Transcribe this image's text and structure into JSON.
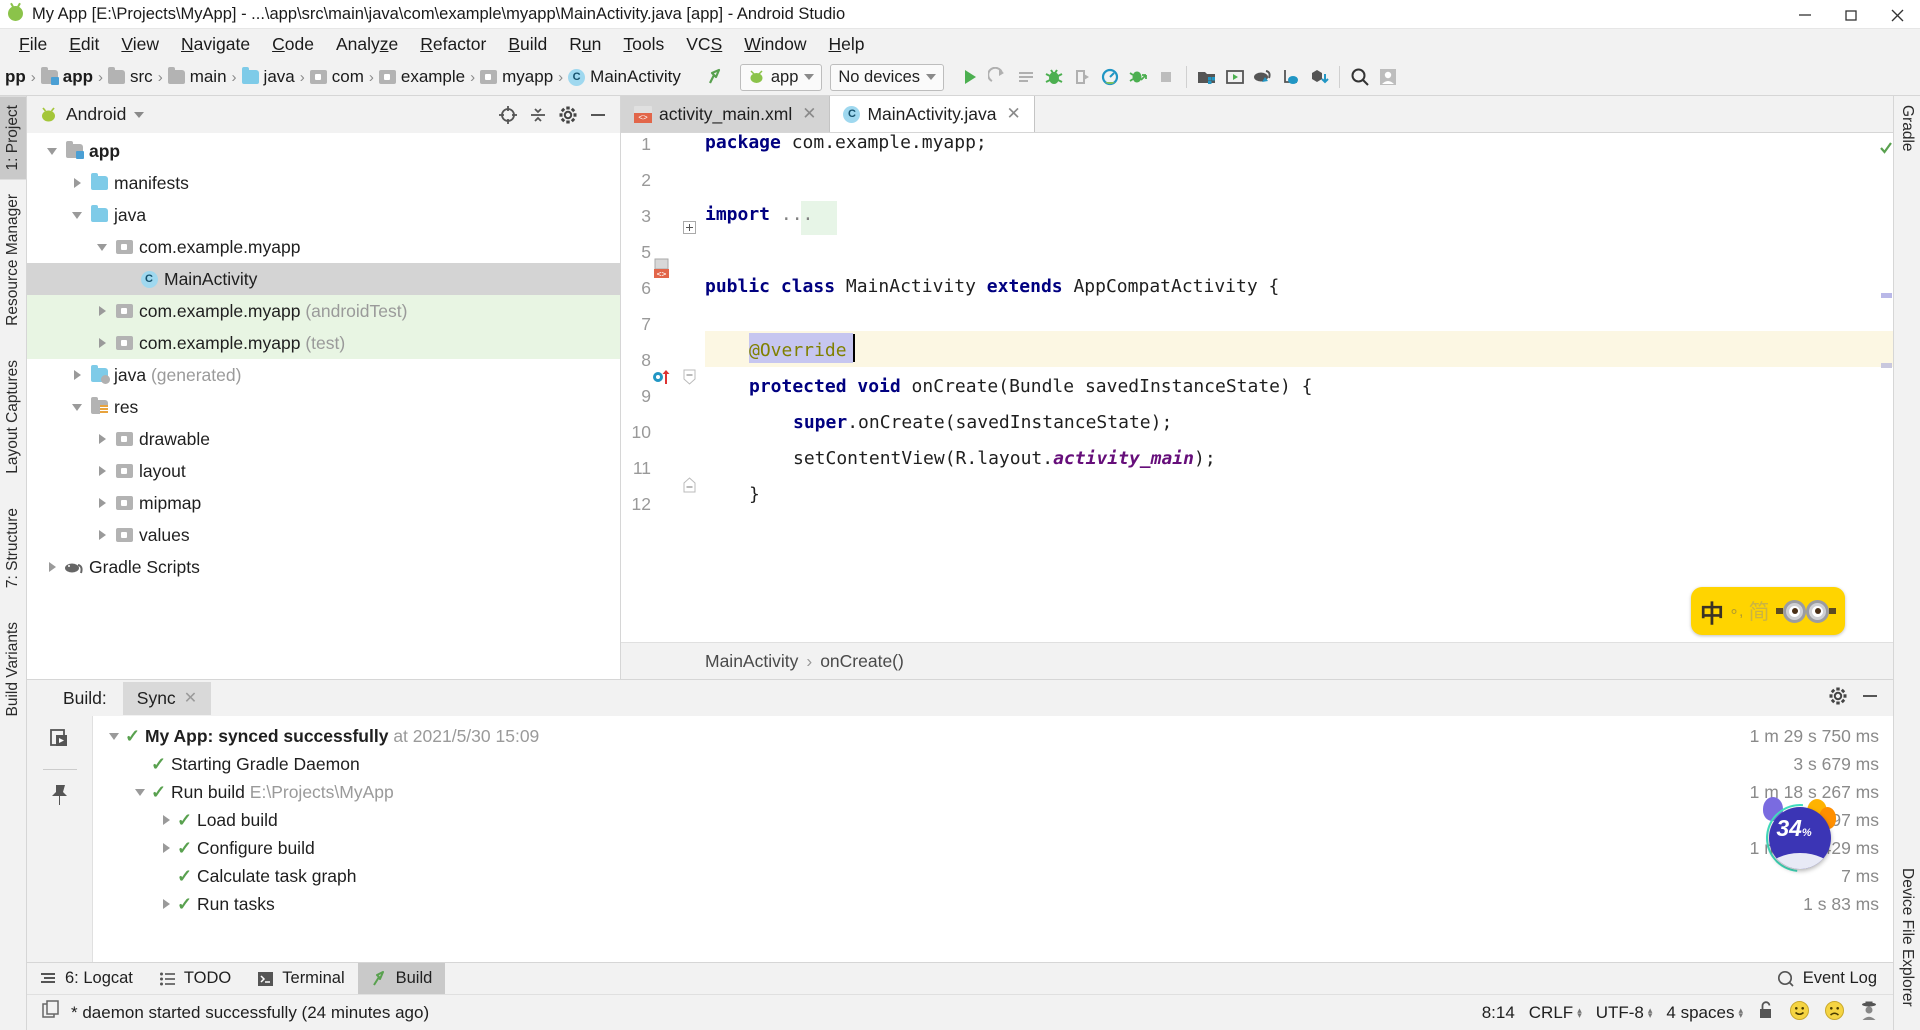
{
  "window": {
    "title": "My App [E:\\Projects\\MyApp] - ...\\app\\src\\main\\java\\com\\example\\myapp\\MainActivity.java [app] - Android Studio",
    "app_icon": "android-icon",
    "minimize": "–",
    "maximize": "❐",
    "close": "✕"
  },
  "menu": {
    "items": [
      {
        "label": "File"
      },
      {
        "label": "Edit"
      },
      {
        "label": "View"
      },
      {
        "label": "Navigate"
      },
      {
        "label": "Code"
      },
      {
        "label": "Analyze"
      },
      {
        "label": "Refactor"
      },
      {
        "label": "Build"
      },
      {
        "label": "Run"
      },
      {
        "label": "Tools"
      },
      {
        "label": "VCS"
      },
      {
        "label": "Window"
      },
      {
        "label": "Help"
      }
    ]
  },
  "navbar": {
    "breadcrumbs": [
      {
        "label": "pp",
        "icon": "none"
      },
      {
        "label": "app",
        "icon": "module-icon"
      },
      {
        "label": "src",
        "icon": "folder-gray-icon"
      },
      {
        "label": "main",
        "icon": "folder-gray-icon"
      },
      {
        "label": "java",
        "icon": "folder-blue-icon"
      },
      {
        "label": "com",
        "icon": "package-icon"
      },
      {
        "label": "example",
        "icon": "package-icon"
      },
      {
        "label": "myapp",
        "icon": "package-icon"
      },
      {
        "label": "MainActivity",
        "icon": "class-icon"
      }
    ],
    "separator": "›",
    "run_config": "app",
    "device_selector": "No devices",
    "buttons": [
      "make-project-icon",
      "run-button",
      "rerun-icon",
      "apply-changes-icon",
      "debug-icon",
      "attach-debugger-icon",
      "profiler-icon",
      "run-with-coverage-icon",
      "stop-icon",
      "sdk-manager-icon",
      "avd-manager-icon",
      "sync-gradle-icon",
      "device-manager-icon",
      "download-icon",
      "search-icon",
      "account-icon"
    ]
  },
  "left_rail": {
    "items": [
      {
        "label": "1: Project",
        "icon": "android-icon",
        "active": true
      },
      {
        "label": "Resource Manager",
        "icon": "resource-icon",
        "active": false
      },
      {
        "label": "Layout Captures",
        "icon": "layout-capture-icon",
        "active": false
      },
      {
        "label": "7: Structure",
        "icon": "structure-icon",
        "active": false
      },
      {
        "label": "Build Variants",
        "icon": "variants-icon",
        "active": false
      }
    ]
  },
  "right_rail": {
    "items": [
      {
        "label": "Gradle",
        "icon": "elephant-icon"
      },
      {
        "label": "Device File Explorer",
        "icon": "device-icon"
      }
    ]
  },
  "project_panel": {
    "title": "Android",
    "dropdown_caret": "▾",
    "tools": [
      "target-icon",
      "collapse-all-icon",
      "settings-gear-icon",
      "hide-icon"
    ],
    "tree": [
      {
        "label": "app",
        "indent": 0,
        "twisty": "down",
        "icon": "module-icon",
        "bold": true,
        "selected": false,
        "bg": "none",
        "suffix": ""
      },
      {
        "label": "manifests",
        "indent": 1,
        "twisty": "right",
        "icon": "folder-blue-icon",
        "bold": false,
        "selected": false,
        "bg": "none",
        "suffix": ""
      },
      {
        "label": "java",
        "indent": 1,
        "twisty": "down",
        "icon": "folder-blue-icon",
        "bold": false,
        "selected": false,
        "bg": "none",
        "suffix": ""
      },
      {
        "label": "com.example.myapp",
        "indent": 2,
        "twisty": "down",
        "icon": "package-icon",
        "bold": false,
        "selected": false,
        "bg": "none",
        "suffix": ""
      },
      {
        "label": "MainActivity",
        "indent": 3,
        "twisty": "none",
        "icon": "class-icon",
        "bold": false,
        "selected": true,
        "bg": "none",
        "suffix": ""
      },
      {
        "label": "com.example.myapp",
        "indent": 2,
        "twisty": "right",
        "icon": "package-icon",
        "bold": false,
        "selected": false,
        "bg": "test",
        "suffix": "(androidTest)"
      },
      {
        "label": "com.example.myapp",
        "indent": 2,
        "twisty": "right",
        "icon": "package-icon",
        "bold": false,
        "selected": false,
        "bg": "test",
        "suffix": "(test)"
      },
      {
        "label": "java",
        "indent": 1,
        "twisty": "right",
        "icon": "folder-generated-icon",
        "bold": false,
        "selected": false,
        "bg": "none",
        "suffix": "(generated)"
      },
      {
        "label": "res",
        "indent": 1,
        "twisty": "down",
        "icon": "res-folder-icon",
        "bold": false,
        "selected": false,
        "bg": "none",
        "suffix": ""
      },
      {
        "label": "drawable",
        "indent": 2,
        "twisty": "right",
        "icon": "package-icon",
        "bold": false,
        "selected": false,
        "bg": "none",
        "suffix": ""
      },
      {
        "label": "layout",
        "indent": 2,
        "twisty": "right",
        "icon": "package-icon",
        "bold": false,
        "selected": false,
        "bg": "none",
        "suffix": ""
      },
      {
        "label": "mipmap",
        "indent": 2,
        "twisty": "right",
        "icon": "package-icon",
        "bold": false,
        "selected": false,
        "bg": "none",
        "suffix": ""
      },
      {
        "label": "values",
        "indent": 2,
        "twisty": "right",
        "icon": "package-icon",
        "bold": false,
        "selected": false,
        "bg": "none",
        "suffix": ""
      },
      {
        "label": "Gradle Scripts",
        "indent": 0,
        "twisty": "right",
        "icon": "elephant-icon",
        "bold": false,
        "selected": false,
        "bg": "none",
        "suffix": ""
      }
    ]
  },
  "editor": {
    "tabs": [
      {
        "label": "activity_main.xml",
        "icon": "xml-layout-icon",
        "active": false,
        "close": "✕"
      },
      {
        "label": "MainActivity.java",
        "icon": "class-icon",
        "active": true,
        "close": "✕"
      }
    ],
    "line_numbers": [
      "1",
      "2",
      "3",
      "5",
      "6",
      "7",
      "8",
      "9",
      "10",
      "11",
      "12"
    ],
    "lines": [
      {
        "num": "1",
        "text": "package com.example.myapp;"
      },
      {
        "num": "2",
        "text": ""
      },
      {
        "num": "3",
        "text": "import ..."
      },
      {
        "num": "5",
        "text": ""
      },
      {
        "num": "6",
        "text": "public class MainActivity extends AppCompatActivity {"
      },
      {
        "num": "7",
        "text": ""
      },
      {
        "num": "8",
        "text": "    @Override"
      },
      {
        "num": "9",
        "text": "    protected void onCreate(Bundle savedInstanceState) {"
      },
      {
        "num": "10",
        "text": "        super.onCreate(savedInstanceState);"
      },
      {
        "num": "11",
        "text": "        setContentView(R.layout.activity_main);"
      },
      {
        "num": "12",
        "text": "    }"
      }
    ],
    "breadcrumb": [
      "MainActivity",
      "onCreate()"
    ],
    "breadcrumb_sep": "›"
  },
  "build_panel": {
    "label": "Build:",
    "tab": "Sync",
    "tab_close": "✕",
    "tools": [
      "settings-gear-icon",
      "hide-icon"
    ],
    "side_buttons": [
      "restart-icon",
      "pin-icon"
    ],
    "rows": [
      {
        "indent": 0,
        "twisty": "down",
        "text": "My App:",
        "bold_text": "synced successfully",
        "dim_text": "at 2021/5/30 15:09",
        "duration": "1 m 29 s 750 ms"
      },
      {
        "indent": 1,
        "twisty": "none",
        "text": "",
        "bold_text": "",
        "plain": "Starting Gradle Daemon",
        "dim_text": "",
        "duration": "3 s 679 ms"
      },
      {
        "indent": 1,
        "twisty": "down",
        "text": "",
        "bold_text": "",
        "plain": "Run build",
        "dim_text": "E:\\Projects\\MyApp",
        "duration": "1 m 18 s 267 ms"
      },
      {
        "indent": 2,
        "twisty": "right",
        "text": "",
        "bold_text": "",
        "plain": "Load build",
        "dim_text": "",
        "duration": "2 s 797 ms"
      },
      {
        "indent": 2,
        "twisty": "right",
        "text": "",
        "bold_text": "",
        "plain": "Configure build",
        "dim_text": "",
        "duration": "1 m 14 s 429 ms"
      },
      {
        "indent": 2,
        "twisty": "none",
        "text": "",
        "bold_text": "",
        "plain": "Calculate task graph",
        "dim_text": "",
        "duration": "7 ms"
      },
      {
        "indent": 2,
        "twisty": "right",
        "text": "",
        "bold_text": "",
        "plain": "Run tasks",
        "dim_text": "",
        "duration": "1 s 83 ms"
      }
    ]
  },
  "bottom_tabs": {
    "items": [
      {
        "label": "6: Logcat",
        "icon": "logcat-icon",
        "active": false
      },
      {
        "label": "TODO",
        "icon": "todo-icon",
        "active": false
      },
      {
        "label": "Terminal",
        "icon": "terminal-icon",
        "active": false
      },
      {
        "label": "Build",
        "icon": "build-hammer-icon",
        "active": true
      }
    ],
    "event_log": "Event Log",
    "event_log_icon": "event-log-icon"
  },
  "status_bar": {
    "message": "* daemon started successfully (24 minutes ago)",
    "message_icon": "copy-icon",
    "caret_position": "8:14",
    "line_separator": "CRLF",
    "encoding": "UTF-8",
    "indent": "4 spaces",
    "lock_icon": "unlocked-icon",
    "icons": [
      "smiley-happy-icon",
      "smiley-sad-icon",
      "inspector-icon"
    ]
  },
  "ime_widget": {
    "mode": "中",
    "punctuation": "∘,",
    "script": "简",
    "icon": "goggles-icon"
  },
  "progress_badge": {
    "percent": "34",
    "percent_symbol": "%"
  },
  "colors": {
    "accent_green": "#59a14f",
    "keyword_blue": "#000080",
    "annotation_olive": "#808000",
    "field_purple": "#660e7a",
    "ime_yellow": "#ffd400",
    "selection": "#c6c6f0"
  }
}
